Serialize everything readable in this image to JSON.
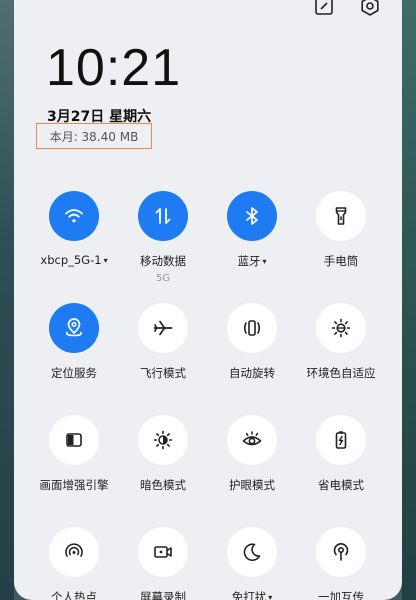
{
  "status": {
    "time": "10:21",
    "date": "3月27日 星期六",
    "data_usage": "本月: 38.40 MB"
  },
  "top_icons": [
    "edit-icon",
    "settings-icon"
  ],
  "tiles": [
    {
      "name": "wifi",
      "label": "xbcp_5G-1",
      "caret": "▾",
      "sub": "",
      "on": true
    },
    {
      "name": "mobile-data",
      "label": "移动数据",
      "caret": "",
      "sub": "5G",
      "on": true
    },
    {
      "name": "bluetooth",
      "label": "蓝牙",
      "caret": "▾",
      "sub": "",
      "on": true
    },
    {
      "name": "flashlight",
      "label": "手电筒",
      "caret": "",
      "sub": "",
      "on": false
    },
    {
      "name": "location",
      "label": "定位服务",
      "caret": "",
      "sub": "",
      "on": true
    },
    {
      "name": "airplane-mode",
      "label": "飞行模式",
      "caret": "",
      "sub": "",
      "on": false
    },
    {
      "name": "auto-rotate",
      "label": "自动旋转",
      "caret": "",
      "sub": "",
      "on": false
    },
    {
      "name": "ambient-display",
      "label": "环境色自适应",
      "caret": "",
      "sub": "",
      "on": false
    },
    {
      "name": "display-enhance",
      "label": "画面增强引擎",
      "caret": "",
      "sub": "",
      "on": false
    },
    {
      "name": "dark-mode",
      "label": "暗色模式",
      "caret": "",
      "sub": "",
      "on": false
    },
    {
      "name": "eye-comfort",
      "label": "护眼模式",
      "caret": "",
      "sub": "",
      "on": false
    },
    {
      "name": "battery-saver",
      "label": "省电模式",
      "caret": "",
      "sub": "",
      "on": false
    },
    {
      "name": "hotspot",
      "label": "个人热点",
      "caret": "",
      "sub": "",
      "on": false
    },
    {
      "name": "screen-record",
      "label": "屏幕录制",
      "caret": "",
      "sub": "",
      "on": false
    },
    {
      "name": "do-not-disturb",
      "label": "免打扰",
      "caret": "▾",
      "sub": "",
      "on": false
    },
    {
      "name": "oneplus-share",
      "label": "一加互传",
      "caret": "",
      "sub": "",
      "on": false
    }
  ],
  "colors": {
    "accent": "#1e7bf2",
    "tile_off": "#ffffff",
    "panel_bg": "#eeeff2",
    "highlight_border": "#f0884c"
  }
}
